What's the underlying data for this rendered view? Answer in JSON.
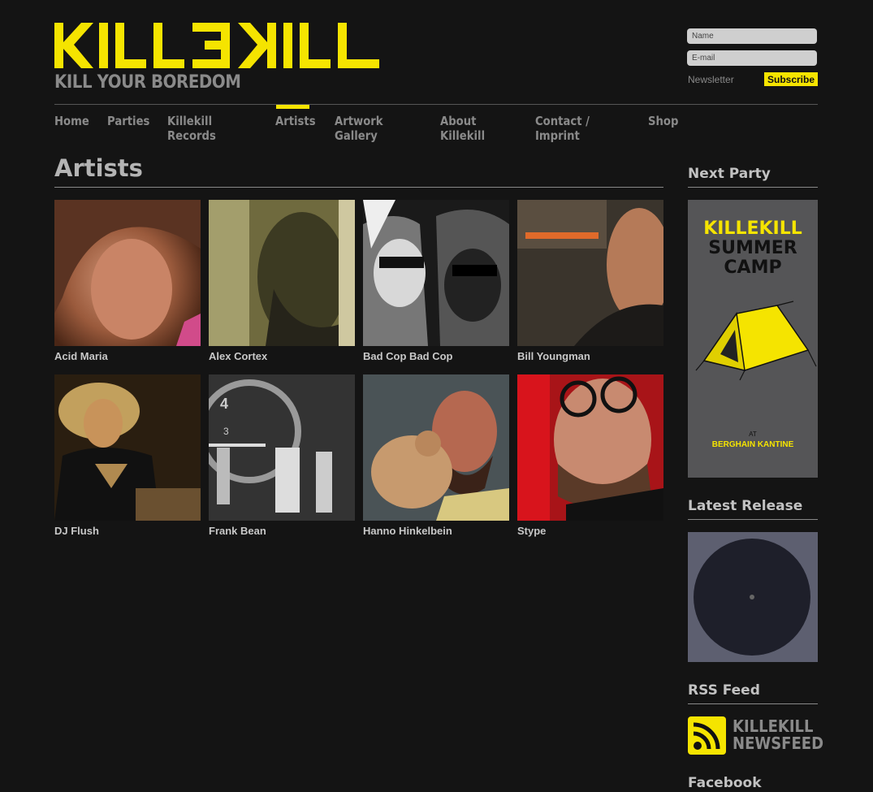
{
  "header": {
    "logo_text": "KILLEKILL",
    "tagline": "KILL YOUR BOREDOM"
  },
  "newsletter": {
    "name_placeholder": "Name",
    "email_placeholder": "E-mail",
    "label": "Newsletter",
    "subscribe_label": "Subscribe"
  },
  "nav": {
    "items": [
      {
        "label": "Home"
      },
      {
        "label": "Parties"
      },
      {
        "label": "Killekill Records"
      },
      {
        "label": "Artists"
      },
      {
        "label": "Artwork Gallery"
      },
      {
        "label": "About Killekill"
      },
      {
        "label": "Contact / Imprint"
      },
      {
        "label": "Shop"
      }
    ],
    "active": "Artists"
  },
  "main": {
    "title": "Artists",
    "artists": [
      {
        "name": "Acid Maria"
      },
      {
        "name": "Alex Cortex"
      },
      {
        "name": "Bad Cop Bad Cop"
      },
      {
        "name": "Bill Youngman"
      },
      {
        "name": "DJ Flush"
      },
      {
        "name": "Frank Bean"
      },
      {
        "name": "Hanno Hinkelbein"
      },
      {
        "name": "Stype"
      }
    ]
  },
  "sidebar": {
    "next_party_title": "Next Party",
    "poster": {
      "logo": "KILLEKILL",
      "line1": "SUMMER",
      "line2": "CAMP",
      "at": "AT",
      "venue": "BERGHAIN KANTINE"
    },
    "latest_release_title": "Latest Release",
    "rss_title": "RSS Feed",
    "rss_line1": "KILLEKILL",
    "rss_line2": "NEWSFEED",
    "facebook_title": "Facebook"
  },
  "colors": {
    "background": "#141414",
    "accent": "#f5e400",
    "text_muted": "#8a8a8a"
  }
}
